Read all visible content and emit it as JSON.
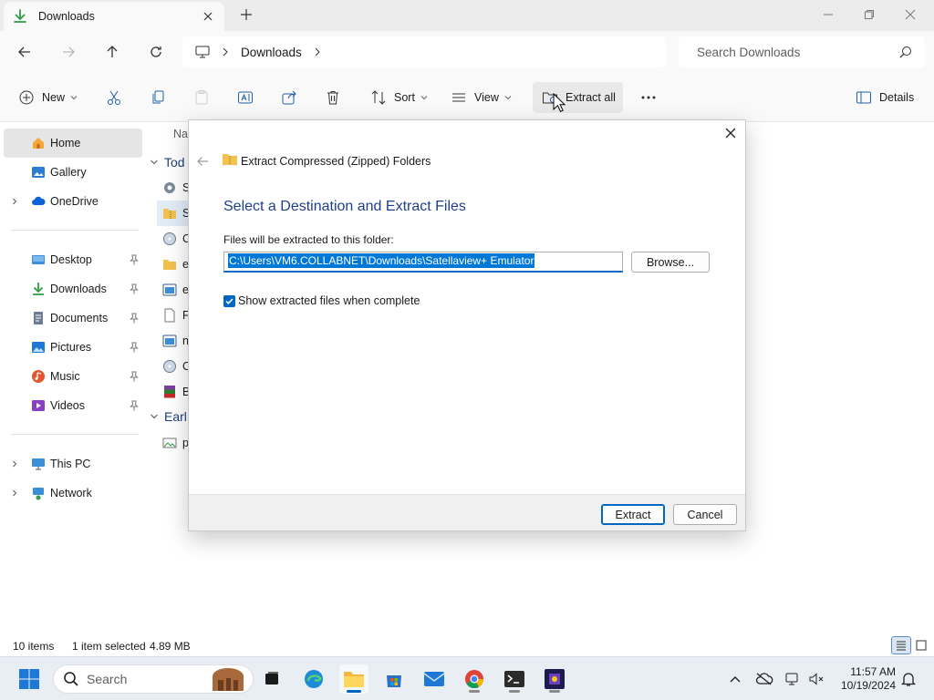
{
  "window": {
    "tab_label": "Downloads"
  },
  "address": {
    "breadcrumb": "Downloads",
    "search_placeholder": "Search Downloads"
  },
  "commands": {
    "new": "New",
    "sort": "Sort",
    "view": "View",
    "extract_all": "Extract all",
    "details": "Details"
  },
  "sidebar": {
    "items": [
      {
        "label": "Home",
        "icon": "home-icon",
        "selected": true
      },
      {
        "label": "Gallery",
        "icon": "gallery-icon"
      },
      {
        "label": "OneDrive",
        "icon": "onedrive-icon",
        "expandable": true
      },
      {
        "label": "Desktop",
        "icon": "desktop-icon",
        "pinned": true
      },
      {
        "label": "Downloads",
        "icon": "downloads-icon",
        "pinned": true
      },
      {
        "label": "Documents",
        "icon": "documents-icon",
        "pinned": true
      },
      {
        "label": "Pictures",
        "icon": "pictures-icon",
        "pinned": true
      },
      {
        "label": "Music",
        "icon": "music-icon",
        "pinned": true
      },
      {
        "label": "Videos",
        "icon": "videos-icon",
        "pinned": true
      },
      {
        "label": "This PC",
        "icon": "this-pc-icon",
        "expandable": true
      },
      {
        "label": "Network",
        "icon": "network-icon",
        "expandable": true
      }
    ]
  },
  "filelist": {
    "column_name": "Na",
    "group_today": "Tod",
    "group_earlier": "Earl",
    "rows": [
      {
        "text": "Sa",
        "icon": "settings-file-icon"
      },
      {
        "text": "Sa",
        "icon": "zip-folder-icon",
        "selected": true
      },
      {
        "text": "C",
        "icon": "cd-file-icon"
      },
      {
        "text": "e",
        "icon": "zip-folder-icon"
      },
      {
        "text": "e",
        "icon": "app-file-icon"
      },
      {
        "text": "Fi",
        "icon": "blank-file-icon"
      },
      {
        "text": "n",
        "icon": "app-file-icon"
      },
      {
        "text": "C",
        "icon": "cd-file-icon"
      },
      {
        "text": "B",
        "icon": "winrar-file-icon"
      },
      {
        "text": "p",
        "icon": "image-file-icon"
      }
    ]
  },
  "status": {
    "item_count": "10 items",
    "selection": "1 item selected",
    "size": "4.89 MB"
  },
  "dialog": {
    "title": "Extract Compressed (Zipped) Folders",
    "heading": "Select a Destination and Extract Files",
    "label": "Files will be extracted to this folder:",
    "path": "C:\\Users\\VM6.COLLABNET\\Downloads\\Satellaview+ Emulator",
    "browse": "Browse...",
    "checkbox_label": "Show extracted files when complete",
    "checkbox_checked": true,
    "extract": "Extract",
    "cancel": "Cancel"
  },
  "taskbar": {
    "search_label": "Search",
    "time": "11:57 AM",
    "date": "10/19/2024"
  },
  "colors": {
    "accent": "#0067c0",
    "heading": "#1f3f8a",
    "selection": "#0078d7"
  }
}
